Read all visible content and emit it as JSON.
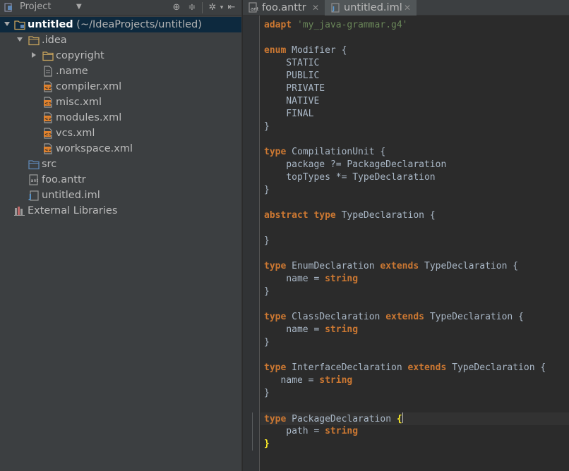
{
  "project_panel": {
    "title": "Project",
    "header_icons": [
      "locate-icon",
      "collapse-icon",
      "gear-icon",
      "hide-icon"
    ]
  },
  "tree": [
    {
      "label": "untitled",
      "path": "(~/IdeaProjects/untitled)",
      "icon": "module-folder-icon",
      "expanded": true,
      "selected": true,
      "depth": 0
    },
    {
      "label": ".idea",
      "icon": "folder-icon",
      "expanded": true,
      "depth": 1
    },
    {
      "label": "copyright",
      "icon": "folder-icon",
      "expanded": false,
      "depth": 2
    },
    {
      "label": ".name",
      "icon": "text-file-icon",
      "depth": 2
    },
    {
      "label": "compiler.xml",
      "icon": "xml-file-icon",
      "depth": 2
    },
    {
      "label": "misc.xml",
      "icon": "xml-file-icon",
      "depth": 2
    },
    {
      "label": "modules.xml",
      "icon": "xml-file-icon",
      "depth": 2
    },
    {
      "label": "vcs.xml",
      "icon": "xml-file-icon",
      "depth": 2
    },
    {
      "label": "workspace.xml",
      "icon": "xml-file-icon",
      "depth": 2
    },
    {
      "label": "src",
      "icon": "source-folder-icon",
      "depth": 1
    },
    {
      "label": "foo.anttr",
      "icon": "anttr-file-icon",
      "depth": 1
    },
    {
      "label": "untitled.iml",
      "icon": "iml-file-icon",
      "depth": 1
    },
    {
      "label": "External Libraries",
      "icon": "libraries-icon",
      "depth": 0
    }
  ],
  "tabs": [
    {
      "label": "foo.anttr",
      "icon": "anttr-file-icon",
      "active": false
    },
    {
      "label": "untitled.iml",
      "icon": "iml-file-icon",
      "active": true
    }
  ],
  "editor": {
    "lines": [
      [
        [
          "kw",
          "adapt"
        ],
        [
          "t",
          " "
        ],
        [
          "str",
          "'my_java-grammar.g4'"
        ]
      ],
      [],
      [
        [
          "kw",
          "enum"
        ],
        [
          "t",
          " Modifier {"
        ]
      ],
      [
        [
          "t",
          "    STATIC"
        ]
      ],
      [
        [
          "t",
          "    PUBLIC"
        ]
      ],
      [
        [
          "t",
          "    PRIVATE"
        ]
      ],
      [
        [
          "t",
          "    NATIVE"
        ]
      ],
      [
        [
          "t",
          "    FINAL"
        ]
      ],
      [
        [
          "t",
          "}"
        ]
      ],
      [],
      [
        [
          "kw",
          "type"
        ],
        [
          "t",
          " CompilationUnit {"
        ]
      ],
      [
        [
          "t",
          "    package ?= PackageDeclaration"
        ]
      ],
      [
        [
          "t",
          "    topTypes *= TypeDeclaration"
        ]
      ],
      [
        [
          "t",
          "}"
        ]
      ],
      [],
      [
        [
          "kw",
          "abstract"
        ],
        [
          "t",
          " "
        ],
        [
          "kw",
          "type"
        ],
        [
          "t",
          " TypeDeclaration {"
        ]
      ],
      [],
      [
        [
          "t",
          "}"
        ]
      ],
      [],
      [
        [
          "kw",
          "type"
        ],
        [
          "t",
          " EnumDeclaration "
        ],
        [
          "kw",
          "extends"
        ],
        [
          "t",
          " TypeDeclaration {"
        ]
      ],
      [
        [
          "t",
          "    name = "
        ],
        [
          "kw",
          "string"
        ]
      ],
      [
        [
          "t",
          "}"
        ]
      ],
      [],
      [
        [
          "kw",
          "type"
        ],
        [
          "t",
          " ClassDeclaration "
        ],
        [
          "kw",
          "extends"
        ],
        [
          "t",
          " TypeDeclaration {"
        ]
      ],
      [
        [
          "t",
          "    name = "
        ],
        [
          "kw",
          "string"
        ]
      ],
      [
        [
          "t",
          "}"
        ]
      ],
      [],
      [
        [
          "kw",
          "type"
        ],
        [
          "t",
          " InterfaceDeclaration "
        ],
        [
          "kw",
          "extends"
        ],
        [
          "t",
          " TypeDeclaration {"
        ]
      ],
      [
        [
          "t",
          "   name = "
        ],
        [
          "kw",
          "string"
        ]
      ],
      [
        [
          "t",
          "}"
        ]
      ],
      [],
      [
        [
          "kw",
          "type"
        ],
        [
          "t",
          " PackageDeclaration "
        ],
        [
          "bm",
          "{"
        ],
        [
          "caret",
          ""
        ]
      ],
      [
        [
          "t",
          "    path = "
        ],
        [
          "kw",
          "string"
        ]
      ],
      [
        [
          "bm",
          "}"
        ]
      ]
    ]
  },
  "colors": {
    "keyword": "#cc7832",
    "string": "#6a8759",
    "text": "#a9b7c6",
    "brace_match": "#ffef28",
    "selection": "#0d293e"
  }
}
